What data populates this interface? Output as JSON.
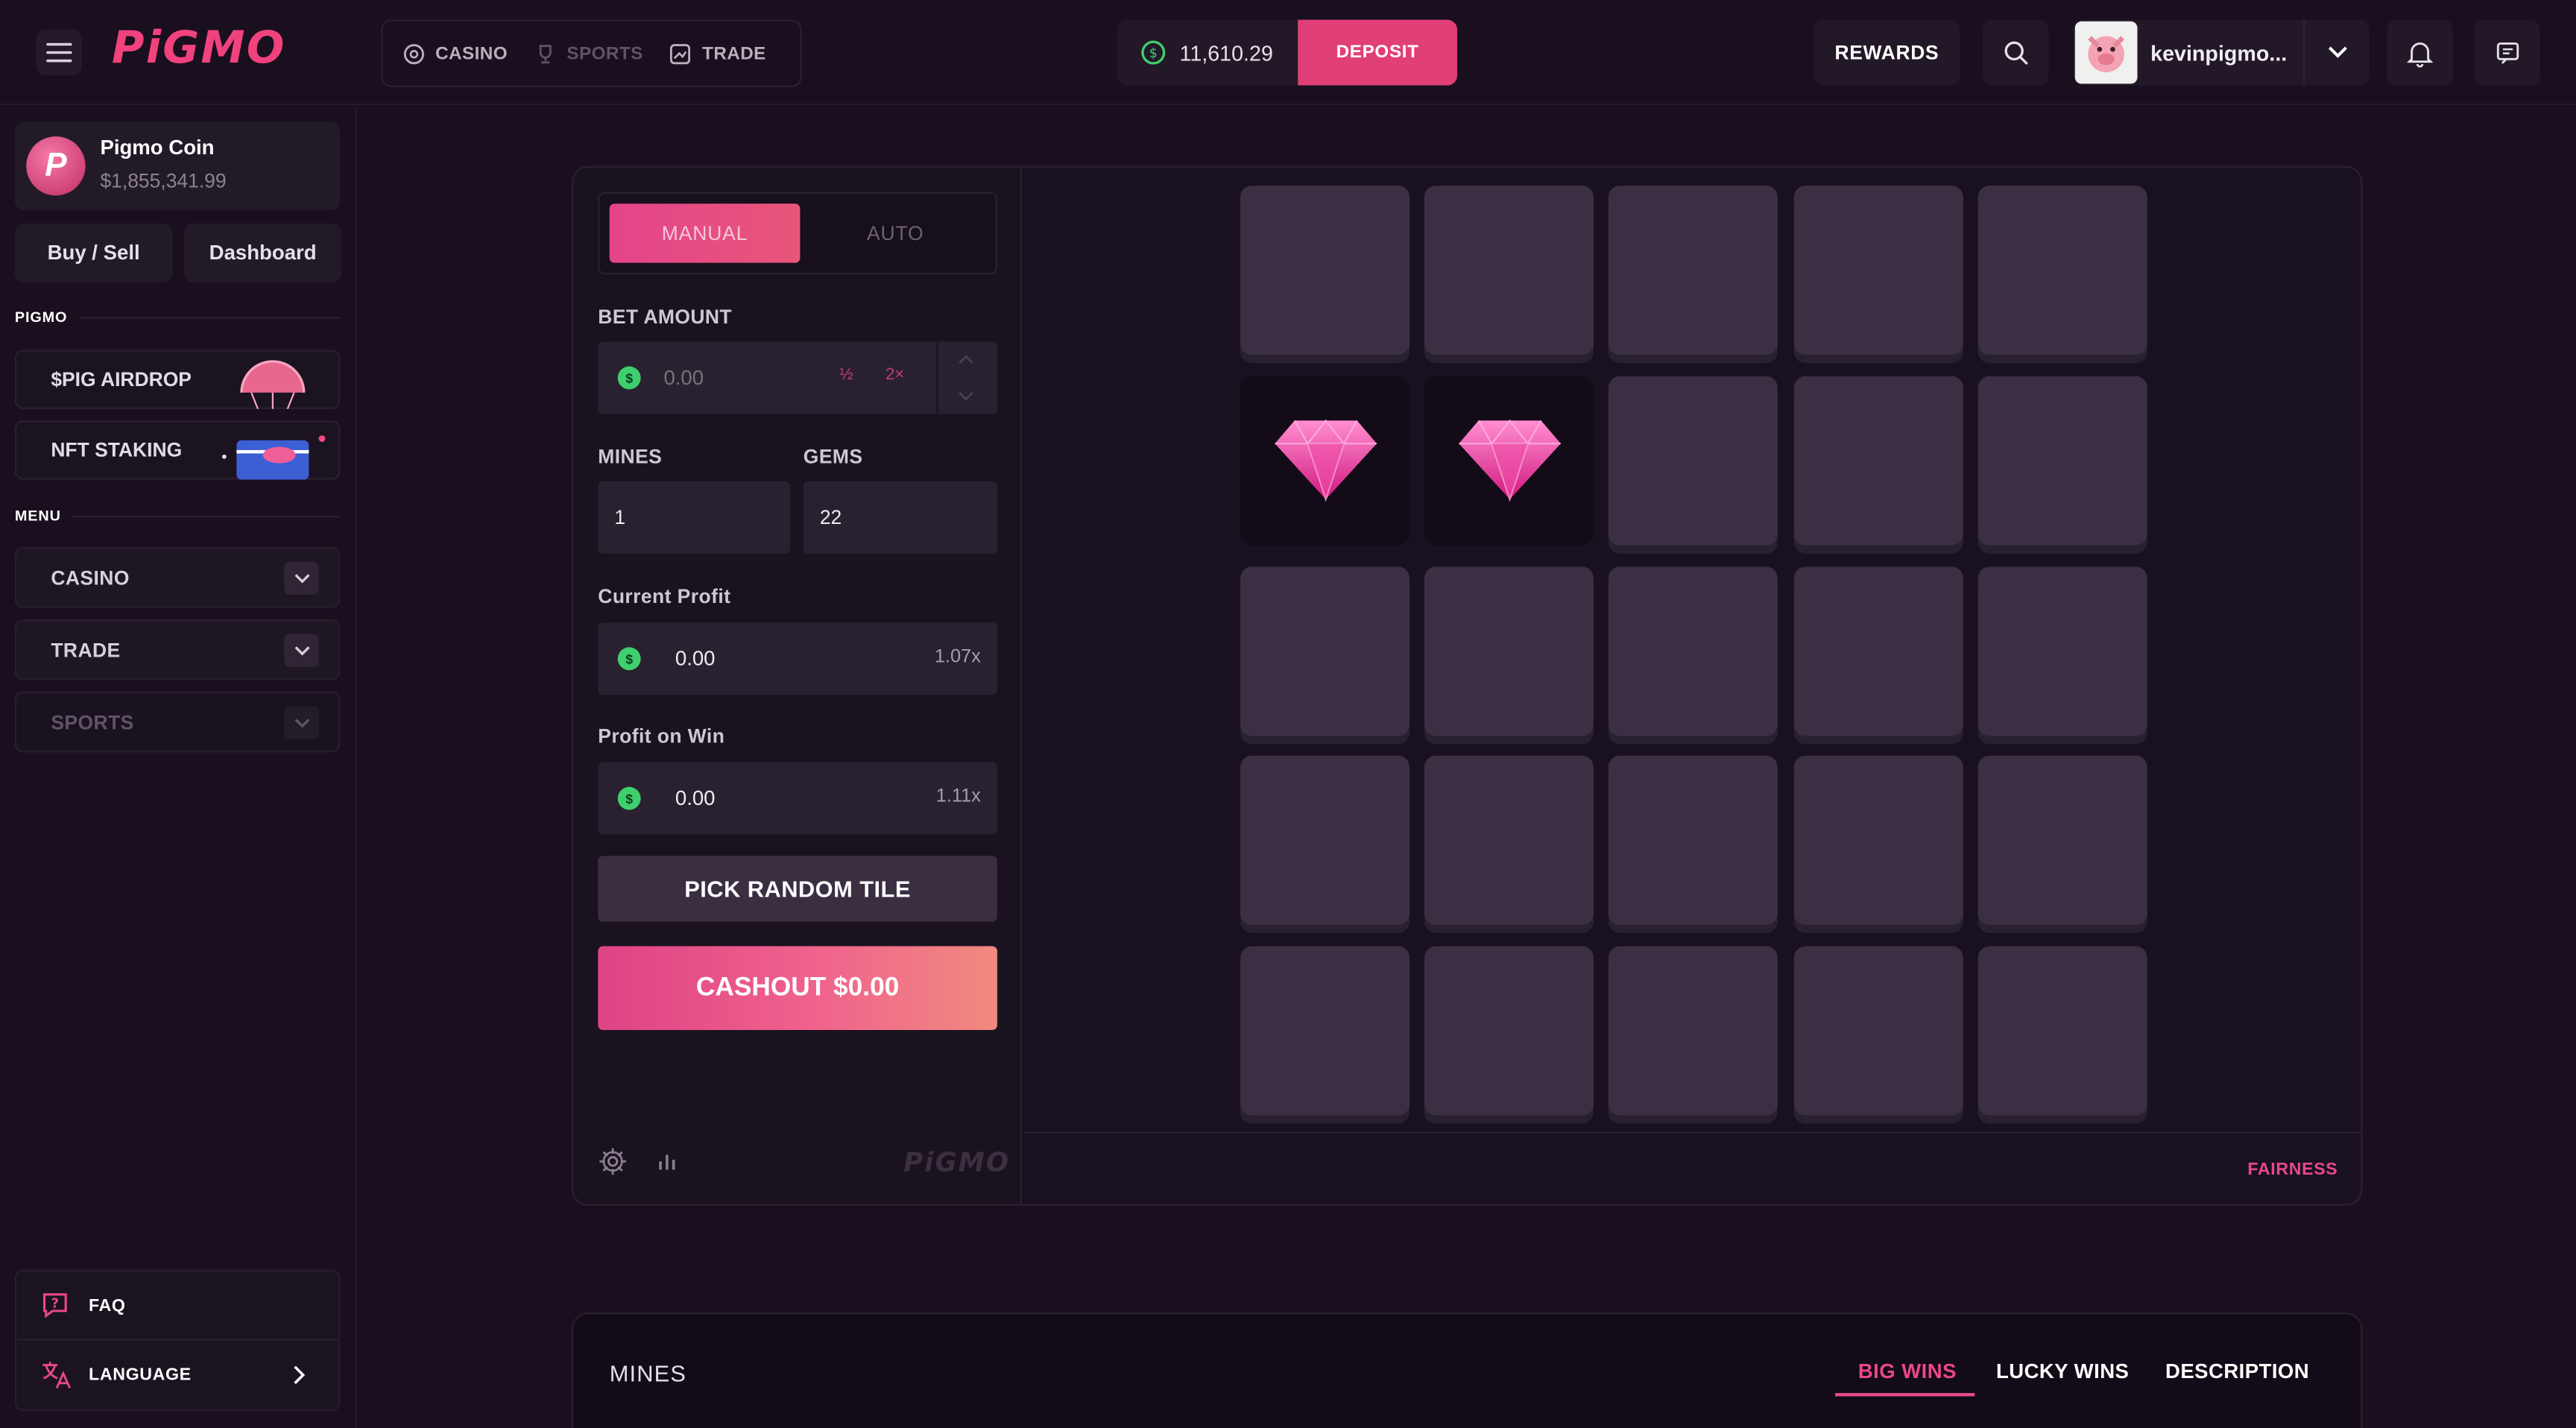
{
  "header": {
    "logo": "PiGMO",
    "nav": [
      {
        "label": "CASINO",
        "icon": "casino-chip-icon"
      },
      {
        "label": "SPORTS",
        "icon": "trophy-icon"
      },
      {
        "label": "TRADE",
        "icon": "chart-icon"
      }
    ],
    "balance": "11,610.29",
    "deposit_label": "DEPOSIT",
    "rewards_label": "REWARDS",
    "username": "kevinpigmo..."
  },
  "sidebar": {
    "coin_name": "Pigmo Coin",
    "coin_price": "$1,855,341.99",
    "buy_sell_label": "Buy / Sell",
    "dashboard_label": "Dashboard",
    "section_pigmo": "PIGMO",
    "airdrop_label": "$PIG AIRDROP",
    "staking_label": "NFT STAKING",
    "section_menu": "MENU",
    "menu": [
      {
        "label": "CASINO"
      },
      {
        "label": "TRADE"
      },
      {
        "label": "SPORTS"
      }
    ],
    "faq_label": "FAQ",
    "language_label": "LANGUAGE"
  },
  "game": {
    "tab_manual": "MANUAL",
    "tab_auto": "AUTO",
    "bet_amount_label": "BET AMOUNT",
    "bet_amount_placeholder": "0.00",
    "half_label": "½",
    "double_label": "2×",
    "mines_label": "MINES",
    "mines_value": "1",
    "gems_label": "GEMS",
    "gems_value": "22",
    "current_profit_label": "Current Profit",
    "current_profit_value": "0.00",
    "current_profit_mult": "1.07x",
    "profit_on_win_label": "Profit on Win",
    "profit_on_win_value": "0.00",
    "profit_on_win_mult": "1.11x",
    "pick_random_label": "PICK RANDOM TILE",
    "cashout_label": "CASHOUT $0.00",
    "footer_logo": "PiGMO",
    "fairness_label": "FAIRNESS",
    "revealed_gems": [
      [
        1,
        0
      ],
      [
        1,
        1
      ]
    ]
  },
  "wins": {
    "title": "MINES",
    "tabs": [
      "BIG WINS",
      "LUCKY WINS",
      "DESCRIPTION"
    ]
  },
  "colors": {
    "accent": "#e8488a",
    "background": "#190f1e",
    "tile": "#3b2f44",
    "money_green": "#3fcf6e"
  }
}
